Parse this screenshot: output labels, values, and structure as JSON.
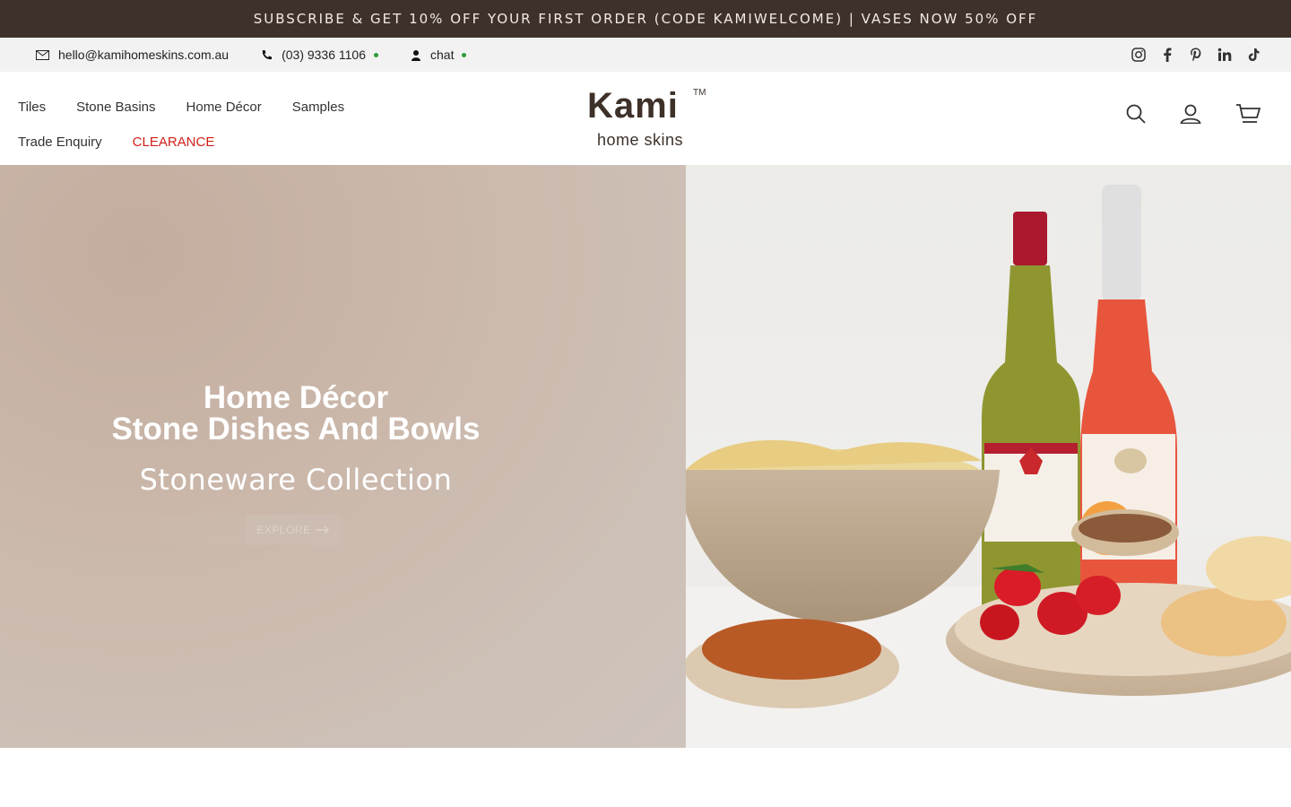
{
  "announcement": {
    "text": "SUBSCRIBE & GET 10% OFF YOUR FIRST ORDER (CODE KAMIWELCOME) | VASES NOW 50% OFF"
  },
  "contact": {
    "email": "hello@kamihomeskins.com.au",
    "phone": "(03) 9336 1106",
    "chat": "chat",
    "status_color": "#2a9d3a"
  },
  "social": [
    "instagram-icon",
    "facebook-icon",
    "pinterest-icon",
    "linkedin-icon",
    "tiktok-icon"
  ],
  "nav": {
    "row1": [
      "Tiles",
      "Stone Basins",
      "Home Décor",
      "Samples"
    ],
    "row2": [
      "Trade Enquiry",
      "CLEARANCE"
    ]
  },
  "logo": {
    "name": "Kami",
    "tm": "TM",
    "tagline": "home skins"
  },
  "header_icons": [
    "search-icon",
    "account-icon",
    "cart-icon"
  ],
  "hero": {
    "line1": "Home Décor",
    "line2": "Stone Dishes And Bowls",
    "subtitle": "Stoneware Collection",
    "button": "EXPLORE"
  },
  "colors": {
    "brand_dark": "#3d3129",
    "clearance": "#d0201a"
  }
}
